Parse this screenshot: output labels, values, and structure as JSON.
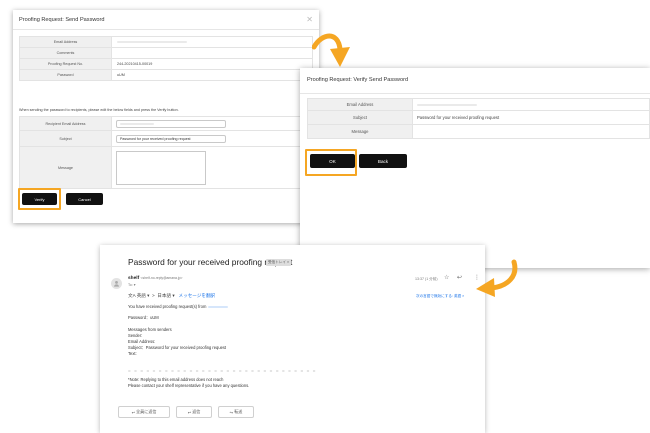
{
  "colors": {
    "highlight": "#f5a623",
    "arrow": "#f5a623",
    "button_dark": "#111111",
    "link_blue": "#1a73e8"
  },
  "send_dialog": {
    "title": "Proofing Request: Send Password",
    "close_icon": "close-icon",
    "rows": [
      {
        "label": "Email Address",
        "value": ""
      },
      {
        "label": "Comments",
        "value": ""
      },
      {
        "label": "Proofing Request No.",
        "value": "244-20210415-00019"
      },
      {
        "label": "Password",
        "value": "uUM"
      }
    ],
    "note": "When sending the password to recipients, please edit the below fields and press the Verify button.",
    "form": {
      "recipient_label": "Recipient Email Address",
      "recipient_value": "",
      "subject_label": "Subject",
      "subject_value": "Password for your received proofing request",
      "message_label": "Message",
      "message_value": ""
    },
    "verify_label": "Verify",
    "cancel_label": "Cancel"
  },
  "verify_dialog": {
    "title": "Proofing Request: Verify Send Password",
    "rows": [
      {
        "label": "Email Address",
        "value": ""
      },
      {
        "label": "Subject",
        "value": "Password for your received proofing request"
      },
      {
        "label": "Message",
        "value": ""
      }
    ],
    "ok_label": "OK",
    "back_label": "Back"
  },
  "email": {
    "subject": "Password for your received proofing request",
    "tag": "受信トレイ ×",
    "avatar_icon": "person-icon",
    "sender_name": "shelf",
    "sender_address": "<shelf-no-reply@amana.jp>",
    "to_line": "To: ▾",
    "time": "13:37 (1 分前)",
    "star_icon": "star-icon",
    "reply_icon": "reply-icon",
    "more_icon": "more-vert-icon",
    "translate_line": {
      "from_lang": "英語",
      "to_lang": "日本語",
      "link": "メッセージを翻訳"
    },
    "translate_right": "次の言語で無効にする: 英語 ×",
    "body": {
      "line1": "You have received proofing request(s) from",
      "password_line": "Password：uUM",
      "messages_heading": "Messages from senders",
      "sender_line": "Sender:",
      "email_line": "Email Address:",
      "subject_line": "Subject：Password for your received proofing request",
      "text_line": "Text:",
      "dashes": "= = = = = = = = = = = = = = = = = = = = = = = = = = = = = = =",
      "note1": "*Note: Replying to this email address does not reach",
      "note2": "Please contact your shelf representative if you have any questions."
    },
    "buttons": {
      "reply_all": "全員に返信",
      "reply": "返信",
      "forward": "転送"
    }
  }
}
